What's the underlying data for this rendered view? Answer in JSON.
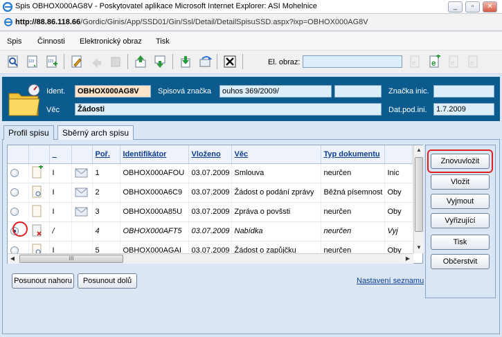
{
  "window": {
    "title": "Spis OBHOX000AG8V - Poskytovatel aplikace Microsoft Internet Explorer: ASI Mohelnice",
    "minimize": "_",
    "restore": "▫",
    "close": "✕"
  },
  "address": {
    "host": "http://88.86.118.66",
    "path": "/Gordic/Ginis/App/SSD01/Gin/Ssl/Detail/DetailSpisuSSD.aspx?ixp=OBHOX000AG8V"
  },
  "menu": {
    "items": [
      "Spis",
      "Činnosti",
      "Elektronický obraz",
      "Tisk"
    ]
  },
  "toolbar": {
    "eobraz_label": "El. obraz:",
    "eobraz_value": ""
  },
  "header": {
    "ident_label": "Ident.",
    "ident_value": "OBHOX000AG8V",
    "spisova_label": "Spisová značka",
    "spisova_value": "ouhos 369/2009/",
    "extra_value": "",
    "znacka_label": "Značka inic.",
    "znacka_value": "",
    "vec_label": "Věc",
    "vec_value": "Žádosti",
    "datpod_label": "Dat.pod.ini.",
    "datpod_value": "1.7.2009"
  },
  "tabs": [
    {
      "label": "Profil spisu"
    },
    {
      "label": "Sběrný arch spisu"
    }
  ],
  "grid": {
    "columns": [
      "",
      "",
      "_",
      "",
      "Poř.",
      "Identifikátor",
      "Vloženo",
      "Věc",
      "Typ dokumentu",
      ""
    ],
    "rows": [
      {
        "mark": "I",
        "por": "1",
        "id": "OBHOX000AFOU",
        "date": "03.07.2009",
        "vec": "Smlouva",
        "typ": "neurčen",
        "extra": "Inic"
      },
      {
        "mark": "I",
        "por": "2",
        "id": "OBHOX000A6C9",
        "date": "03.07.2009",
        "vec": "Žádost o podání zprávy",
        "typ": "Běžná písemnost",
        "extra": "Oby"
      },
      {
        "mark": "I",
        "por": "3",
        "id": "OBHOX000A85U",
        "date": "03.07.2009",
        "vec": "Zpráva o povšsti",
        "typ": "neurčen",
        "extra": "Oby"
      },
      {
        "mark": "/",
        "por": "4",
        "id": "OBHOX000AFT5",
        "date": "03.07.2009",
        "vec": "Nabídka",
        "typ": "neurčen",
        "extra": "Vyj"
      },
      {
        "mark": "I",
        "por": "5",
        "id": "OBHOX000AGAI",
        "date": "03.07.2009",
        "vec": "Žádost o zapůjčku",
        "typ": "neurčen",
        "extra": "Oby"
      }
    ],
    "hscroll_grip": "III"
  },
  "bottom": {
    "up_label": "Posunout nahoru",
    "down_label": "Posunout dolů",
    "settings_link": "Nastavení seznamu"
  },
  "actions": {
    "znovuvlozit": "Znovuvložit",
    "vlozit": "Vložit",
    "vyjmout": "Vyjmout",
    "vyrizujici": "Vyřizující",
    "tisk": "Tisk",
    "obcerstvit": "Občerstvit"
  }
}
